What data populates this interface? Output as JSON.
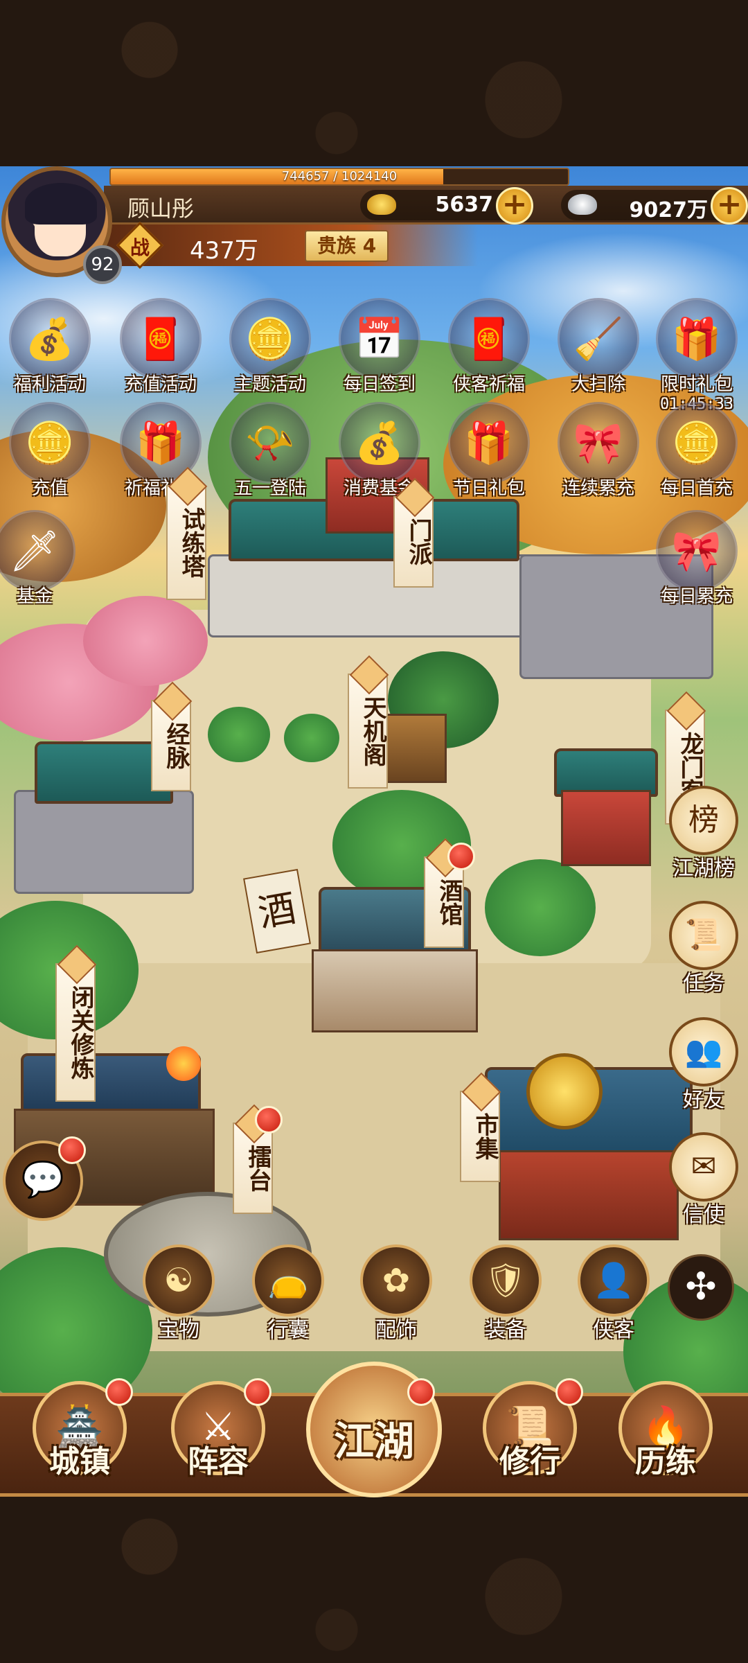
{
  "player": {
    "name": "顾山彤",
    "level": "92",
    "xp_text": "744657 / 1024140",
    "xp_progress": 0.727,
    "power_label": "战",
    "power_value": "437万",
    "noble_rank": "贵族 4"
  },
  "currency": {
    "gold": "5637",
    "silver": "9027万",
    "plus_symbol": "+"
  },
  "activities_row1": [
    {
      "label": "福利活动",
      "icon": "lucky-bag-icon"
    },
    {
      "label": "充值活动",
      "icon": "red-envelope-icon"
    },
    {
      "label": "主题活动",
      "icon": "gold-ingot-icon"
    },
    {
      "label": "每日签到",
      "icon": "calendar-icon"
    },
    {
      "label": "侠客祈福",
      "icon": "red-envelope-icon"
    },
    {
      "label": "大扫除",
      "icon": "broom-icon"
    },
    {
      "label": "限时礼包",
      "icon": "gift-bag-icon"
    }
  ],
  "limited_timer": "01:45:33",
  "activities_row2": [
    {
      "label": "充值",
      "icon": "gold-ingot-icon"
    },
    {
      "label": "祈福礼包",
      "icon": "gift-bag-icon"
    },
    {
      "label": "五一登陆",
      "icon": "horn-icon"
    },
    {
      "label": "消费基金",
      "icon": "lucky-bag-icon"
    },
    {
      "label": "节日礼包",
      "icon": "gift-bag-icon"
    },
    {
      "label": "连续累充",
      "icon": "treasure-box-icon"
    },
    {
      "label": "每日首充",
      "icon": "gold-ingot-icon"
    }
  ],
  "activities_row3": [
    {
      "label": "基金",
      "icon": "sword-icon"
    },
    {
      "label": "每日累充",
      "icon": "treasure-box-icon"
    }
  ],
  "buildings": {
    "training_tower": "试练塔",
    "sect": "门派",
    "meridian": "经脉",
    "tianji": "天机阁",
    "dragon_gate": "龙门客",
    "tavern": "酒馆",
    "retreat": "闭关修炼",
    "arena": "擂台",
    "market": "市集",
    "tavern_sign": "酒"
  },
  "side_buttons": [
    {
      "label": "江湖榜",
      "glyph": "榜"
    },
    {
      "label": "任务",
      "glyph": "📜"
    },
    {
      "label": "好友",
      "glyph": "👥"
    },
    {
      "label": "信使",
      "glyph": "✉"
    }
  ],
  "chat": {
    "glyph": "💬"
  },
  "equipment": [
    {
      "label": "宝物",
      "glyph": "☯"
    },
    {
      "label": "行囊",
      "glyph": "👝"
    },
    {
      "label": "配饰",
      "glyph": "✿"
    },
    {
      "label": "装备",
      "glyph": "🛡"
    },
    {
      "label": "侠客",
      "glyph": "👤"
    }
  ],
  "expand": {
    "glyph": "✣"
  },
  "bottom_nav": [
    {
      "label": "城镇",
      "glyph": "🏯"
    },
    {
      "label": "阵容",
      "glyph": "⚔"
    },
    {
      "label": "江湖",
      "glyph": ""
    },
    {
      "label": "修行",
      "glyph": "📜"
    },
    {
      "label": "历练",
      "glyph": "🔥"
    }
  ],
  "colors": {
    "frame_brown": "#5b3a22",
    "gold_accent": "#f1c57a",
    "notify_red": "#d8261a"
  }
}
